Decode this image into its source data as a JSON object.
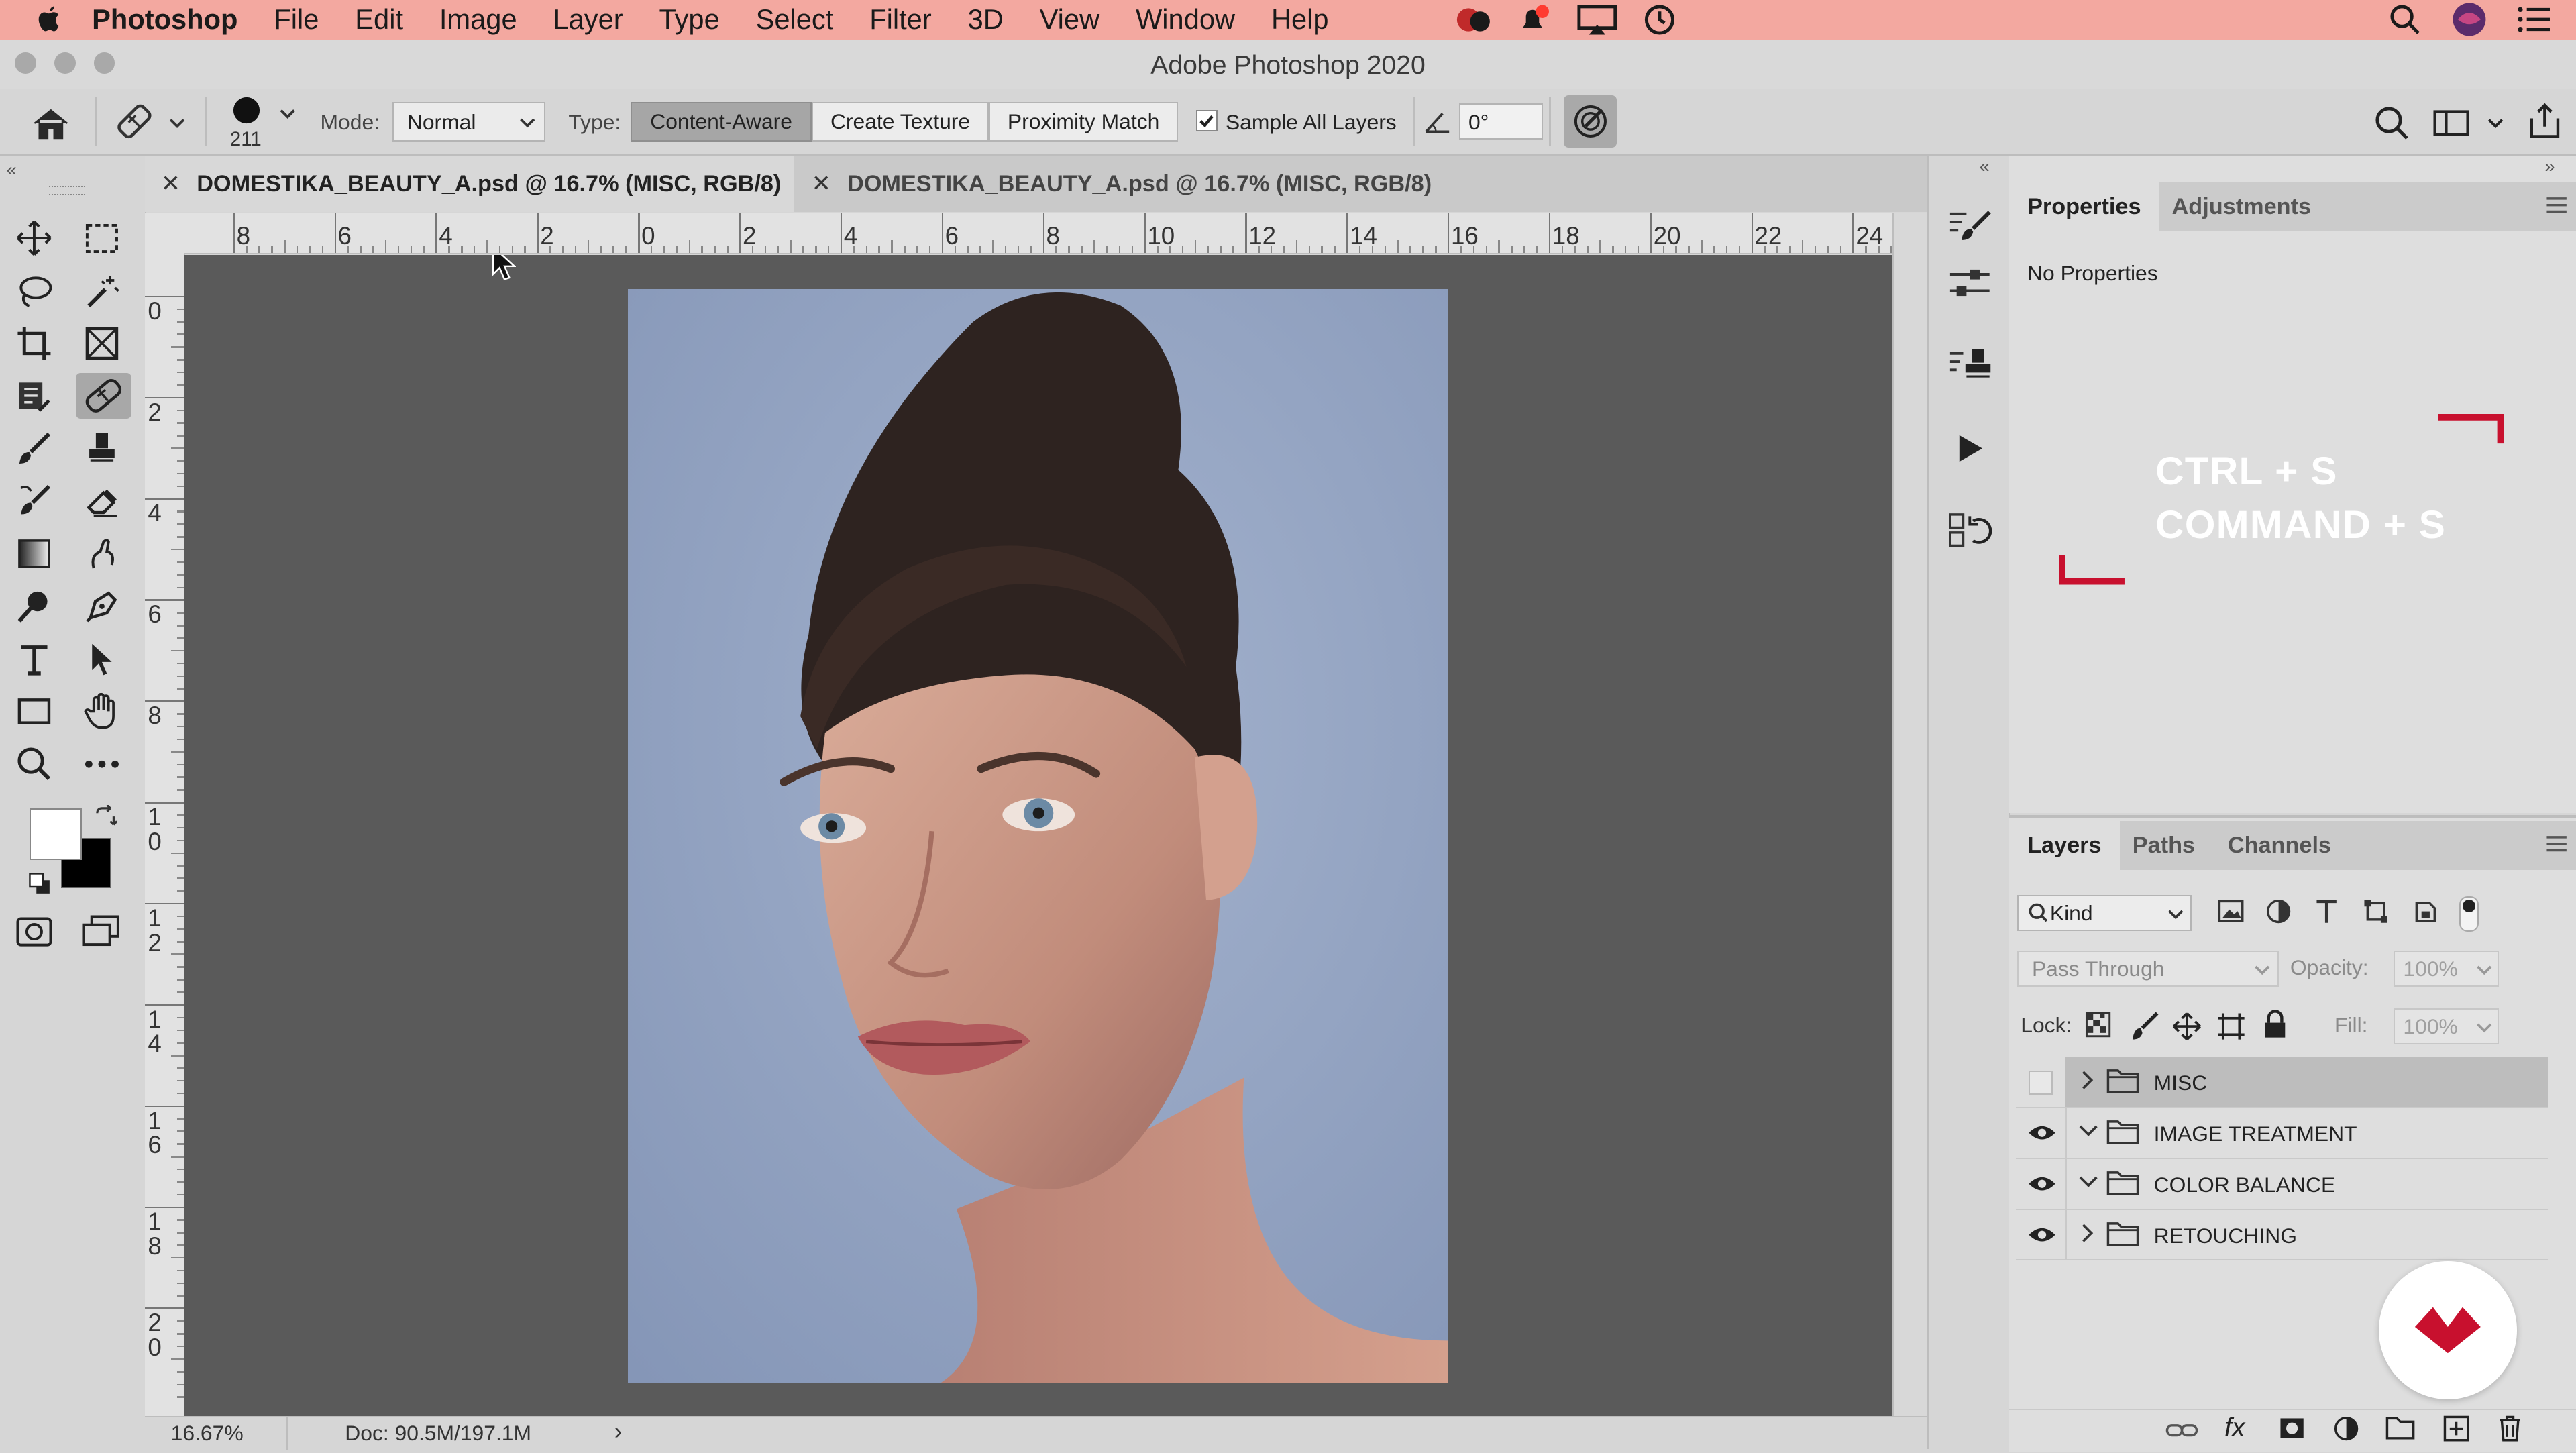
{
  "menubar": {
    "app": "Photoshop",
    "items": [
      "File",
      "Edit",
      "Image",
      "Layer",
      "Type",
      "Select",
      "Filter",
      "3D",
      "View",
      "Window",
      "Help"
    ]
  },
  "window": {
    "title": "Adobe Photoshop 2020"
  },
  "options": {
    "brush_size": "211",
    "mode_label": "Mode:",
    "mode_value": "Normal",
    "type_label": "Type:",
    "type_buttons": [
      "Content-Aware",
      "Create Texture",
      "Proximity Match"
    ],
    "sample_all_layers": "Sample All Layers",
    "angle_value": "0°"
  },
  "tabs": [
    {
      "label": "DOMESTIKA_BEAUTY_A.psd @ 16.7% (MISC, RGB/8)"
    },
    {
      "label": "DOMESTIKA_BEAUTY_A.psd @ 16.7% (MISC, RGB/8)"
    }
  ],
  "rulers": {
    "h": [
      "8",
      "6",
      "4",
      "2",
      "0",
      "2",
      "4",
      "6",
      "8",
      "10",
      "12",
      "14",
      "16",
      "18",
      "20",
      "22",
      "24"
    ],
    "v": [
      "0",
      "2",
      "4",
      "6",
      "8",
      "1\n0",
      "1\n2",
      "1\n4",
      "1\n6",
      "1\n8",
      "2\n0"
    ]
  },
  "status": {
    "zoom": "16.67%",
    "doc": "Doc: 90.5M/197.1M"
  },
  "properties": {
    "tabs": [
      "Properties",
      "Adjustments"
    ],
    "content": "No Properties",
    "overlay_line1": "CTRL + S",
    "overlay_line2": "COMMAND + S"
  },
  "layers_panel": {
    "tabs": [
      "Layers",
      "Paths",
      "Channels"
    ],
    "kind_filter": "Kind",
    "blend_mode": "Pass Through",
    "opacity_label": "Opacity:",
    "opacity_value": "100%",
    "lock_label": "Lock:",
    "fill_label": "Fill:",
    "fill_value": "100%",
    "layers": [
      {
        "name": "MISC",
        "visible": false,
        "expanded": false
      },
      {
        "name": "IMAGE TREATMENT",
        "visible": true,
        "expanded": true
      },
      {
        "name": "COLOR BALANCE",
        "visible": true,
        "expanded": true
      },
      {
        "name": "RETOUCHING",
        "visible": true,
        "expanded": false
      }
    ]
  },
  "colors": {
    "accent_red": "#c8102e",
    "menubar": "#f3a8a0"
  }
}
